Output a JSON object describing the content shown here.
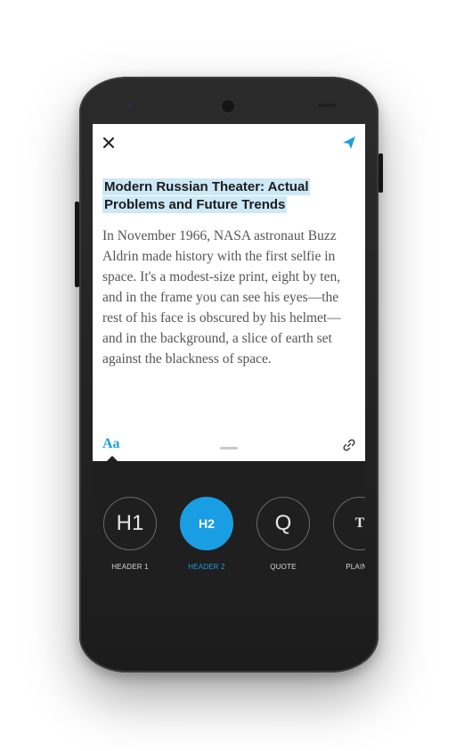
{
  "header": {
    "close_icon": "close-icon",
    "send_icon": "send-icon",
    "accent_color": "#1a9ee3"
  },
  "document": {
    "title": "Modern Russian Theater: Actual Problems and Future Trends",
    "body": "In November 1966, NASA astronaut Buzz Aldrin made history with the first selfie in space.  It's a modest-size print, eight by ten, and in the frame you can see his eyes—the rest of his face is obscured by his helmet—and in the background, a slice of earth set against the blackness of space."
  },
  "toolbar": {
    "font_label": "Aa",
    "link_icon": "link-icon"
  },
  "styles": [
    {
      "glyph": "H1",
      "label": "HEADER 1",
      "active": false
    },
    {
      "glyph": "H2",
      "label": "HEADER 2",
      "active": true
    },
    {
      "glyph": "Q",
      "label": "QUOTE",
      "active": false
    },
    {
      "glyph": "T",
      "label": "PLAIN T",
      "active": false
    }
  ]
}
